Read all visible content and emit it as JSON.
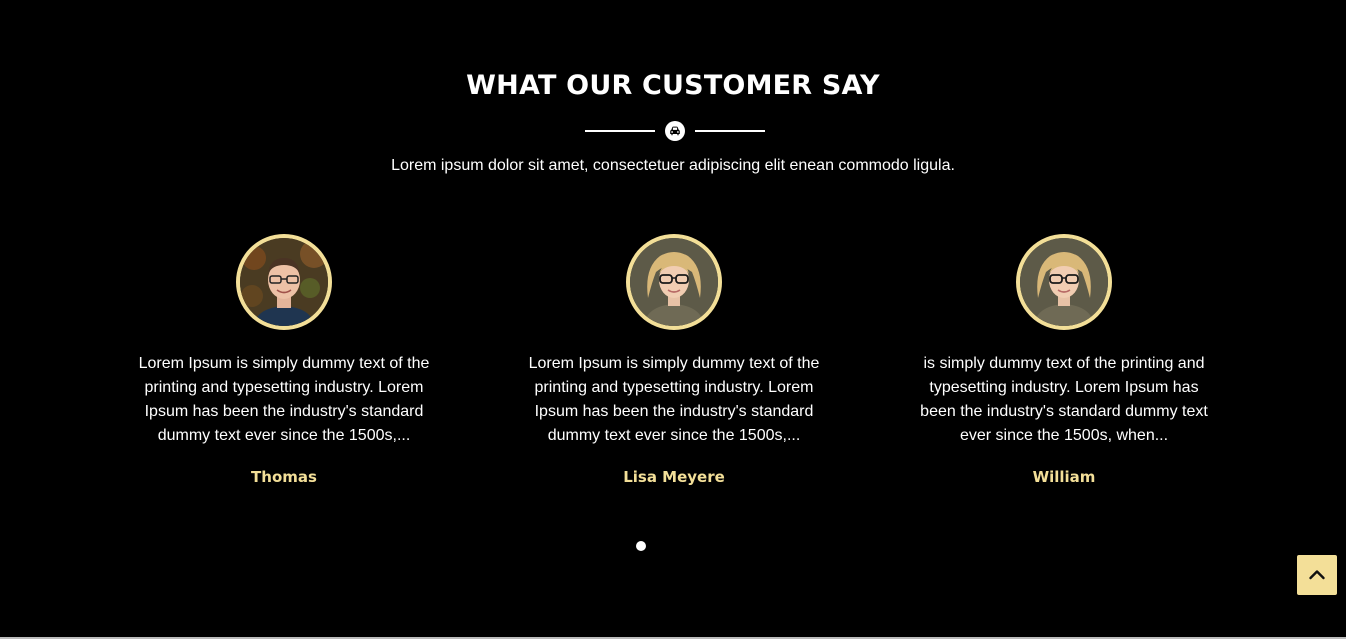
{
  "section": {
    "title": "WHAT OUR CUSTOMER SAY",
    "subtitle": "Lorem ipsum dolor sit amet, consectetuer adipiscing elit enean commodo ligula.",
    "divider_icon": "car-icon"
  },
  "testimonials": [
    {
      "quote": "Lorem Ipsum is simply dummy text of the printing and typesetting industry. Lorem Ipsum has been the industry's standard dummy text ever since the 1500s,...",
      "name": "Thomas"
    },
    {
      "quote": "Lorem Ipsum is simply dummy text of the printing and typesetting industry. Lorem Ipsum has been the industry's standard dummy text ever since the 1500s,...",
      "name": "Lisa Meyere"
    },
    {
      "quote": "is simply dummy text of the printing and typesetting industry. Lorem Ipsum has been the industry's standard dummy text ever since the 1500s, when...",
      "name": "William"
    }
  ],
  "carousel": {
    "dot_count": 1,
    "active_dot": 1
  },
  "back_to_top_icon": "chevron-up-icon",
  "colors": {
    "background": "#000000",
    "accent": "#f3df98",
    "text": "#ffffff"
  }
}
